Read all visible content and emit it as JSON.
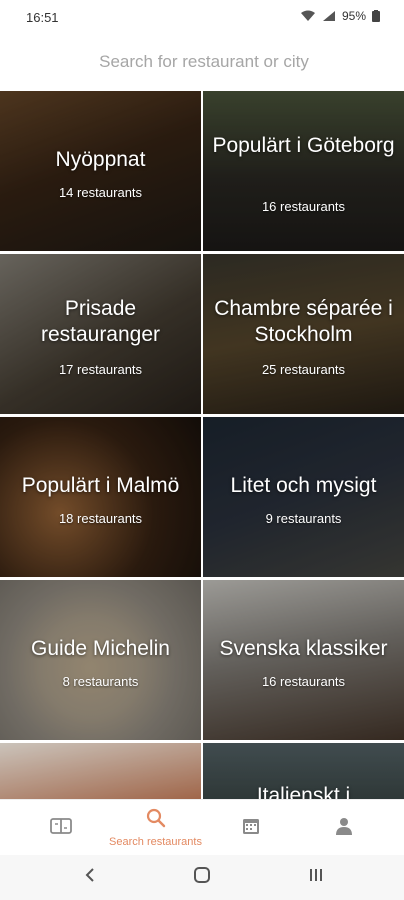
{
  "status_bar": {
    "time": "16:51",
    "battery": "95%"
  },
  "search": {
    "placeholder": "Search for restaurant or city"
  },
  "collections": [
    {
      "title": "Nyöppnat",
      "count": "14 restaurants"
    },
    {
      "title": "Populärt i Göteborg",
      "count": "16 restaurants"
    },
    {
      "title": "Prisade restauranger",
      "count": "17 restaurants"
    },
    {
      "title": "Chambre séparée i Stockholm",
      "count": "25 restaurants"
    },
    {
      "title": "Populärt i Malmö",
      "count": "18 restaurants"
    },
    {
      "title": "Litet och mysigt",
      "count": "9 restaurants"
    },
    {
      "title": "Guide Michelin",
      "count": "8 restaurants"
    },
    {
      "title": "Svenska klassiker",
      "count": "16 restaurants"
    },
    {
      "title": "",
      "count": ""
    },
    {
      "title": "Italienskt i",
      "count": ""
    }
  ],
  "bottom_nav": {
    "items": [
      {
        "icon": "bookings-icon",
        "label": ""
      },
      {
        "icon": "search-icon",
        "label": "Search restaurants",
        "active": true
      },
      {
        "icon": "calendar-icon",
        "label": ""
      },
      {
        "icon": "profile-icon",
        "label": ""
      }
    ]
  },
  "colors": {
    "accent": "#e38a62",
    "nav_icon": "#8a8a8a"
  }
}
